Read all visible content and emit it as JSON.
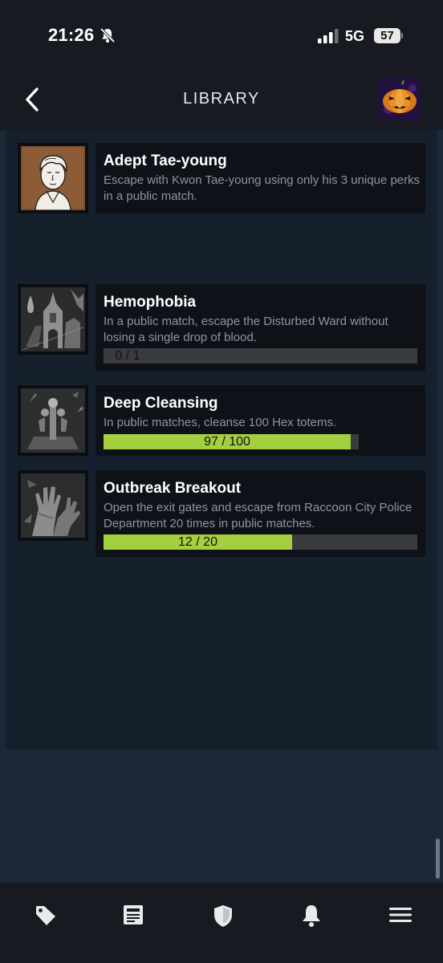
{
  "status_bar": {
    "time": "21:26",
    "network": "5G",
    "battery": "57",
    "icons": [
      "bell-slash-icon",
      "cellular-signal-icon",
      "battery-icon"
    ]
  },
  "header": {
    "title": "LIBRARY",
    "back_icon": "chevron-left-icon",
    "avatar_icon": "pumpkin-avatar"
  },
  "achievements": [
    {
      "title": "Adept Tae-young",
      "description": "Escape with Kwon Tae-young using only his 3 unique perks in a public match.",
      "icon": "portrait-icon"
    },
    {
      "title": "Hemophobia",
      "description": "In a public match, escape the Disturbed Ward without losing a single drop of blood.",
      "progress": {
        "label": "0 / 1",
        "current": 0,
        "total": 1
      },
      "icon": "chapel-blood-drop-icon"
    },
    {
      "title": "Deep Cleansing",
      "description": "In public matches, cleanse 100 Hex totems.",
      "progress": {
        "label": "97 / 100",
        "current": 97,
        "total": 100
      },
      "icon": "totem-icon"
    },
    {
      "title": "Outbreak Breakout",
      "description": "Open the exit gates and escape from Raccoon City Police Department 20 times in public matches.",
      "progress": {
        "label": "12 / 20",
        "current": 12,
        "total": 20
      },
      "icon": "grasping-hands-icon"
    }
  ],
  "bottom_nav": {
    "items": [
      "tag-icon",
      "news-icon",
      "shield-icon",
      "bell-icon",
      "menu-icon"
    ]
  },
  "colors": {
    "background": "#1b2838",
    "header": "#171a21",
    "card": "#0e1218",
    "progress_fill": "#a4cf3e",
    "progress_track": "#3a3b3e"
  }
}
